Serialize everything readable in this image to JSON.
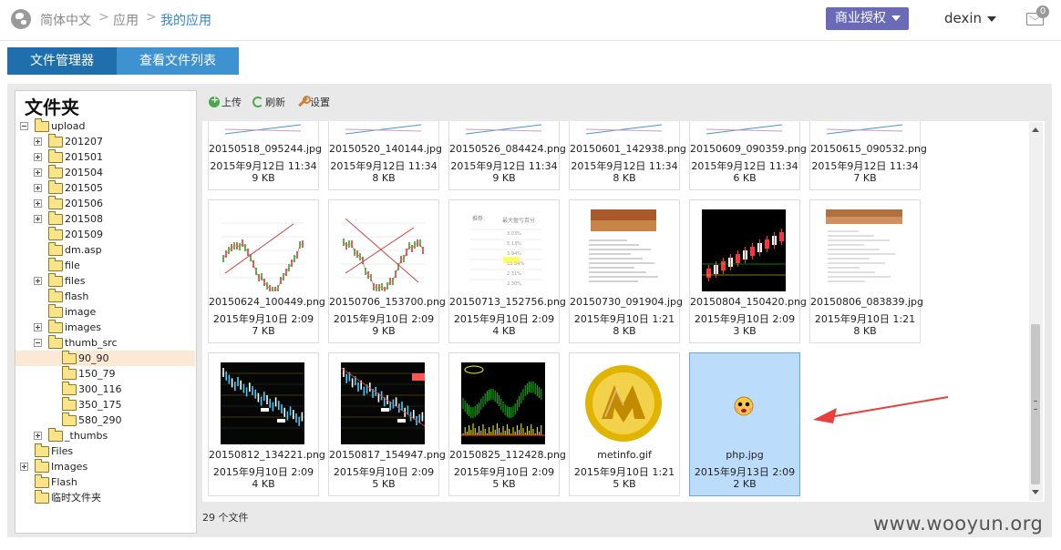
{
  "header": {
    "breadcrumb": [
      "简体中文",
      "应用",
      "我的应用"
    ],
    "breadcrumb_sep": ">",
    "license_button": "商业授权",
    "user": "dexin",
    "mail_count": "0"
  },
  "tabs": [
    "文件管理器",
    "查看文件列表"
  ],
  "tree": {
    "title": "文件夹",
    "nodes": [
      "upload",
      "201207",
      "201501",
      "201504",
      "201505",
      "201506",
      "201508",
      "201509",
      "dm.asp",
      "file",
      "files",
      "flash",
      "image",
      "images",
      "thumb_src",
      "90_90",
      "150_79",
      "300_116",
      "350_175",
      "580_290",
      "_thumbs",
      "Files",
      "Images",
      "Flash",
      "临时文件夹"
    ]
  },
  "toolbar": {
    "upload": "上传",
    "refresh": "刷新",
    "settings": "设置"
  },
  "files": [
    {
      "name": "20150518_095244.jpg",
      "date": "2015年9月12日 11:34",
      "size": "9 KB"
    },
    {
      "name": "20150520_140144.jpg",
      "date": "2015年9月12日 11:34",
      "size": "8 KB"
    },
    {
      "name": "20150526_084424.png",
      "date": "2015年9月12日 11:34",
      "size": "9 KB"
    },
    {
      "name": "20150601_142938.png",
      "date": "2015年9月12日 11:34",
      "size": "8 KB"
    },
    {
      "name": "20150609_090359.png",
      "date": "2015年9月12日 11:34",
      "size": "6 KB"
    },
    {
      "name": "20150615_090532.png",
      "date": "2015年9月12日 11:34",
      "size": "7 KB"
    },
    {
      "name": "20150624_100449.png",
      "date": "2015年9月10日 2:09",
      "size": "7 KB"
    },
    {
      "name": "20150706_153700.png",
      "date": "2015年9月10日 2:09",
      "size": "9 KB"
    },
    {
      "name": "20150713_152756.png",
      "date": "2015年9月10日 2:09",
      "size": "4 KB"
    },
    {
      "name": "20150730_091904.jpg",
      "date": "2015年9月10日 1:21",
      "size": "8 KB"
    },
    {
      "name": "20150804_150420.png",
      "date": "2015年9月10日 2:09",
      "size": "3 KB"
    },
    {
      "name": "20150806_083839.jpg",
      "date": "2015年9月10日 1:21",
      "size": "8 KB"
    },
    {
      "name": "20150812_134221.png",
      "date": "2015年9月10日 2:09",
      "size": "4 KB"
    },
    {
      "name": "20150817_154947.png",
      "date": "2015年9月10日 2:09",
      "size": "5 KB"
    },
    {
      "name": "20150825_112428.png",
      "date": "2015年9月10日 2:09",
      "size": "5 KB"
    },
    {
      "name": "metinfo.gif",
      "date": "2015年9月10日 1:21",
      "size": "5 KB"
    },
    {
      "name": "php.jpg",
      "date": "2015年9月13日 2:09",
      "size": "2 KB"
    }
  ],
  "status": "29 个文件",
  "watermark": "www.wooyun.org",
  "colors": {
    "accent": "#1e6fac",
    "tab_light": "#3e92cf",
    "license": "#6a6ab8",
    "selected_file": "#bcdcfb",
    "arrow": "#e8413b"
  }
}
